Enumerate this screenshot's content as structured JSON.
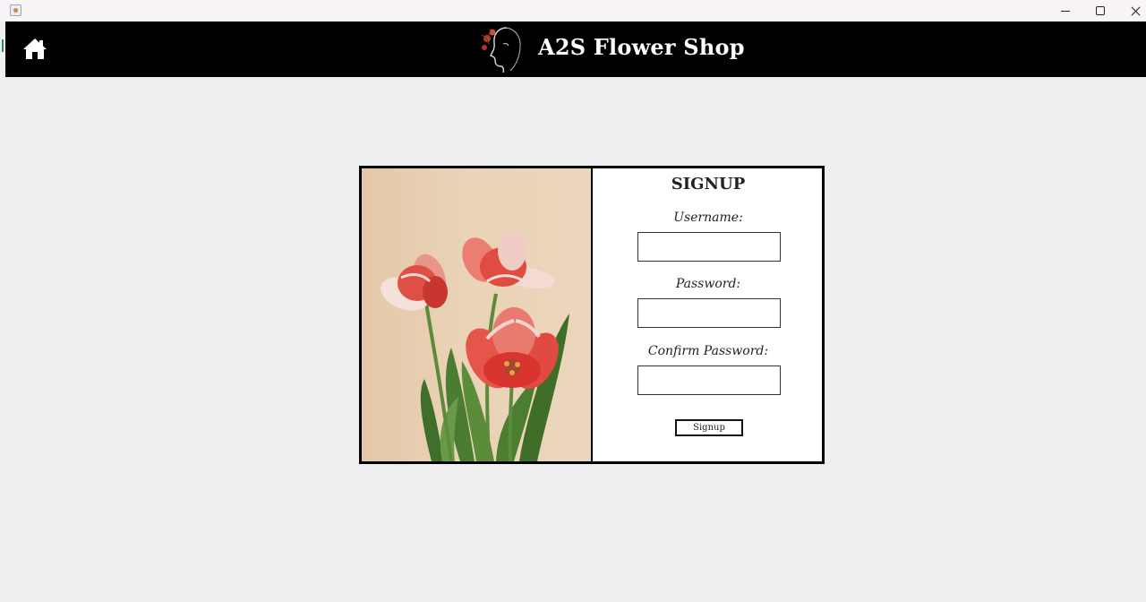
{
  "window": {
    "icon": "java-app-icon",
    "controls": [
      "minimize-icon",
      "maximize-icon",
      "close-icon"
    ]
  },
  "header": {
    "home_icon": "home-icon",
    "logo_icon": "woman-flower-logo",
    "title": "A2S Flower Shop",
    "background": "#000000",
    "title_color": "#ffffff"
  },
  "signup": {
    "title": "SIGNUP",
    "username_label": "Username:",
    "username_value": "",
    "password_label": "Password:",
    "password_value": "",
    "confirm_label": "Confirm Password:",
    "confirm_value": "",
    "button_label": "Signup",
    "image": "red-white-tulips-photo"
  }
}
